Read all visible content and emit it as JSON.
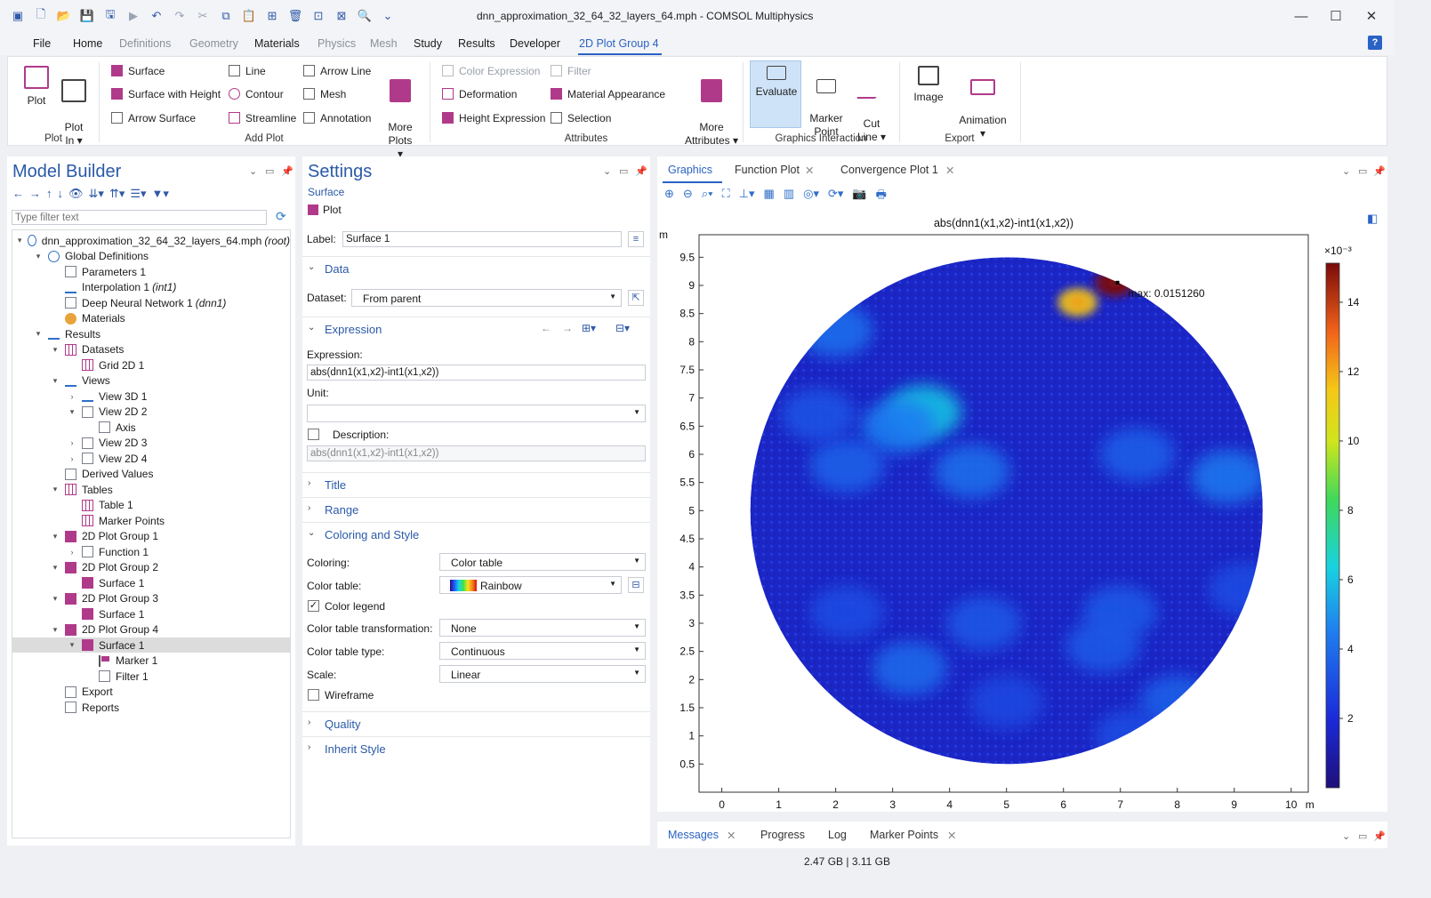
{
  "window": {
    "title": "dnn_approximation_32_64_32_layers_64.mph - COMSOL Multiphysics",
    "minimize": "—",
    "maximize": "☐",
    "close": "✕"
  },
  "menu": [
    "File",
    "Home",
    "Definitions",
    "Geometry",
    "Materials",
    "Physics",
    "Mesh",
    "Study",
    "Results",
    "Developer",
    "2D Plot Group 4"
  ],
  "help_label": "?",
  "ribbon": {
    "plot": {
      "label": "Plot"
    },
    "plot_in": {
      "label": "Plot\nIn ▾"
    },
    "add_plot": [
      "Surface",
      "Surface with Height",
      "Arrow Surface",
      "Line",
      "Contour",
      "Streamline",
      "Arrow Line",
      "Mesh",
      "Annotation"
    ],
    "more_plots": "More\nPlots ▾",
    "attributes": [
      "Color Expression",
      "Deformation",
      "Height Expression",
      "Filter",
      "Material Appearance",
      "Selection"
    ],
    "more_attributes": "More\nAttributes ▾",
    "evaluate": "Evaluate",
    "marker_point": "Marker\nPoint",
    "cut_line": "Cut\nLine ▾",
    "image": "Image",
    "animation": "Animation\n▾",
    "groups": [
      "Plot",
      "Add Plot",
      "Attributes",
      "Graphics Interaction",
      "Export"
    ]
  },
  "model_builder": {
    "title": "Model Builder",
    "filter_placeholder": "Type filter text",
    "tree": [
      {
        "label": "dnn_approximation_32_64_32_layers_64.mph",
        "tag": "(root)",
        "depth": 0,
        "tw": "▾",
        "icon": "blue"
      },
      {
        "label": "Global Definitions",
        "tag": "",
        "depth": 1,
        "tw": "▾",
        "icon": "blue"
      },
      {
        "label": "Parameters 1",
        "tag": "",
        "depth": 2,
        "tw": "",
        "icon": "gen"
      },
      {
        "label": "Interpolation 1",
        "tag": "(int1)",
        "depth": 2,
        "tw": "",
        "icon": "line"
      },
      {
        "label": "Deep Neural Network 1",
        "tag": "(dnn1)",
        "depth": 2,
        "tw": "",
        "icon": "gen"
      },
      {
        "label": "Materials",
        "tag": "",
        "depth": 2,
        "tw": "",
        "icon": "orange"
      },
      {
        "label": "Results",
        "tag": "",
        "depth": 1,
        "tw": "▾",
        "icon": "line"
      },
      {
        "label": "Datasets",
        "tag": "",
        "depth": 2,
        "tw": "▾",
        "icon": "grid"
      },
      {
        "label": "Grid 2D 1",
        "tag": "",
        "depth": 3,
        "tw": "",
        "icon": "grid"
      },
      {
        "label": "Views",
        "tag": "",
        "depth": 2,
        "tw": "▾",
        "icon": "line"
      },
      {
        "label": "View 3D 1",
        "tag": "",
        "depth": 3,
        "tw": "›",
        "icon": "line"
      },
      {
        "label": "View 2D 2",
        "tag": "",
        "depth": 3,
        "tw": "▾",
        "icon": "gen"
      },
      {
        "label": "Axis",
        "tag": "",
        "depth": 4,
        "tw": "",
        "icon": "gen"
      },
      {
        "label": "View 2D 3",
        "tag": "",
        "depth": 3,
        "tw": "›",
        "icon": "gen"
      },
      {
        "label": "View 2D 4",
        "tag": "",
        "depth": 3,
        "tw": "›",
        "icon": "gen"
      },
      {
        "label": "Derived Values",
        "tag": "",
        "depth": 2,
        "tw": "",
        "icon": "gen"
      },
      {
        "label": "Tables",
        "tag": "",
        "depth": 2,
        "tw": "▾",
        "icon": "grid"
      },
      {
        "label": "Table 1",
        "tag": "",
        "depth": 3,
        "tw": "",
        "icon": "grid"
      },
      {
        "label": "Marker Points",
        "tag": "",
        "depth": 3,
        "tw": "",
        "icon": "grid"
      },
      {
        "label": "2D Plot Group 1",
        "tag": "",
        "depth": 2,
        "tw": "▾",
        "icon": "mag"
      },
      {
        "label": "Function 1",
        "tag": "",
        "depth": 3,
        "tw": "›",
        "icon": "gen"
      },
      {
        "label": "2D Plot Group 2",
        "tag": "",
        "depth": 2,
        "tw": "▾",
        "icon": "mag"
      },
      {
        "label": "Surface 1",
        "tag": "",
        "depth": 3,
        "tw": "",
        "icon": "mag"
      },
      {
        "label": "2D Plot Group 3",
        "tag": "",
        "depth": 2,
        "tw": "▾",
        "icon": "mag"
      },
      {
        "label": "Surface 1",
        "tag": "",
        "depth": 3,
        "tw": "",
        "icon": "mag"
      },
      {
        "label": "2D Plot Group 4",
        "tag": "",
        "depth": 2,
        "tw": "▾",
        "icon": "mag"
      },
      {
        "label": "Surface 1",
        "tag": "",
        "depth": 3,
        "tw": "▾",
        "icon": "mag",
        "selected": true
      },
      {
        "label": "Marker 1",
        "tag": "",
        "depth": 4,
        "tw": "",
        "icon": "flag"
      },
      {
        "label": "Filter 1",
        "tag": "",
        "depth": 4,
        "tw": "",
        "icon": "gen"
      },
      {
        "label": "Export",
        "tag": "",
        "depth": 2,
        "tw": "",
        "icon": "gen"
      },
      {
        "label": "Reports",
        "tag": "",
        "depth": 2,
        "tw": "",
        "icon": "gen"
      }
    ]
  },
  "settings": {
    "title": "Settings",
    "subtitle": "Surface",
    "plot_button": "Plot",
    "label_label": "Label:",
    "label_value": "Surface 1",
    "section_data": "Data",
    "dataset_label": "Dataset:",
    "dataset_value": "From parent",
    "section_expression": "Expression",
    "expression_label": "Expression:",
    "expression_value": "abs(dnn1(x1,x2)-int1(x1,x2))",
    "unit_label": "Unit:",
    "unit_value": "",
    "description_label": "Description:",
    "description_value": "abs(dnn1(x1,x2)-int1(x1,x2))",
    "section_title": "Title",
    "section_range": "Range",
    "section_coloring": "Coloring and Style",
    "coloring_label": "Coloring:",
    "coloring_value": "Color table",
    "color_table_label": "Color table:",
    "color_table_value": "Rainbow",
    "color_legend_label": "Color legend",
    "color_legend_checked": "✓",
    "transform_label": "Color table transformation:",
    "transform_value": "None",
    "ctype_label": "Color table type:",
    "ctype_value": "Continuous",
    "scale_label": "Scale:",
    "scale_value": "Linear",
    "wireframe_label": "Wireframe",
    "section_quality": "Quality",
    "section_inherit": "Inherit Style"
  },
  "graphics": {
    "tabs": [
      "Graphics",
      "Function Plot",
      "Convergence Plot 1"
    ],
    "tab_close": "✕"
  },
  "chart_data": {
    "type": "heatmap",
    "title": "abs(dnn1(x1,x2)-int1(x1,x2))",
    "x_unit": "m",
    "y_unit": "m",
    "x_ticks": [
      0,
      1,
      2,
      3,
      4,
      5,
      6,
      7,
      8,
      9,
      10
    ],
    "y_ticks": [
      0.5,
      1,
      1.5,
      2,
      2.5,
      3,
      3.5,
      4,
      4.5,
      5,
      5.5,
      6,
      6.5,
      7,
      7.5,
      8,
      8.5,
      9,
      9.5
    ],
    "xlim": [
      -0.4,
      10.3
    ],
    "ylim": [
      0,
      9.9
    ],
    "domain": {
      "shape": "circle",
      "center": [
        5,
        5
      ],
      "radius": 4.5
    },
    "colorbar": {
      "scale_label": "×10⁻³",
      "ticks": [
        2,
        4,
        6,
        8,
        10,
        12,
        14
      ],
      "range": [
        0,
        15.126
      ],
      "colormap": "Rainbow"
    },
    "max_annotation": {
      "text": "max: 0.0151260",
      "x": 6.95,
      "y": 9.05
    },
    "hotspots": [
      {
        "x": 6.9,
        "y": 9.05,
        "value": 15.1
      },
      {
        "x": 6.25,
        "y": 8.7,
        "value": 11.5
      },
      {
        "x": 3.55,
        "y": 6.75,
        "value": 6.0
      },
      {
        "x": 3.1,
        "y": 6.5,
        "value": 4.5
      },
      {
        "x": 4.4,
        "y": 5.7,
        "value": 4.0
      },
      {
        "x": 8.9,
        "y": 5.6,
        "value": 4.2
      },
      {
        "x": 7.3,
        "y": 6.0,
        "value": 3.5
      },
      {
        "x": 2.2,
        "y": 5.8,
        "value": 3.6
      },
      {
        "x": 1.7,
        "y": 6.7,
        "value": 3.2
      },
      {
        "x": 7.0,
        "y": 3.2,
        "value": 3.4
      },
      {
        "x": 4.6,
        "y": 3.0,
        "value": 3.3
      },
      {
        "x": 3.3,
        "y": 2.2,
        "value": 3.8
      },
      {
        "x": 6.7,
        "y": 2.6,
        "value": 3.4
      },
      {
        "x": 8.0,
        "y": 1.6,
        "value": 3.6
      },
      {
        "x": 7.2,
        "y": 1.0,
        "value": 3.0
      },
      {
        "x": 2.2,
        "y": 3.2,
        "value": 3.0
      },
      {
        "x": 2.0,
        "y": 8.2,
        "value": 4.0
      },
      {
        "x": 5.0,
        "y": 1.6,
        "value": 2.8
      },
      {
        "x": 9.2,
        "y": 3.6,
        "value": 3.0
      }
    ]
  },
  "messages": {
    "tabs": [
      "Messages",
      "Progress",
      "Log",
      "Marker Points"
    ]
  },
  "status": {
    "memory": "2.47 GB | 3.11 GB"
  },
  "colors": {
    "accent": "#2b62c5",
    "plot_mag": "#b03a8a",
    "panel_title": "#2a5aa8"
  }
}
